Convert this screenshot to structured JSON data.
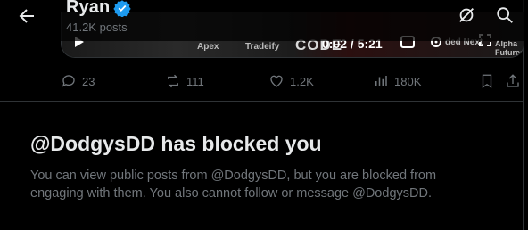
{
  "header": {
    "name": "Ryan",
    "posts_count": "41.2K posts"
  },
  "video": {
    "time": "0:02 / 5:21",
    "sponsors": [
      "Apex",
      "Tradeify",
      "CODE",
      "ded Next",
      "Alpha Futures"
    ]
  },
  "actions": {
    "replies": "23",
    "reposts": "111",
    "likes": "1.2K",
    "views": "180K"
  },
  "blocked": {
    "title": "@DodgysDD has blocked you",
    "description": "You can view public posts from @DodgysDD, but you are blocked from engaging with them. You also cannot follow or message @DodgysDD."
  },
  "colors": {
    "background": "#000000",
    "text_primary": "#e7e9ea",
    "text_secondary": "#71767b",
    "divider": "#2f3336",
    "verified": "#1d9bf0"
  }
}
